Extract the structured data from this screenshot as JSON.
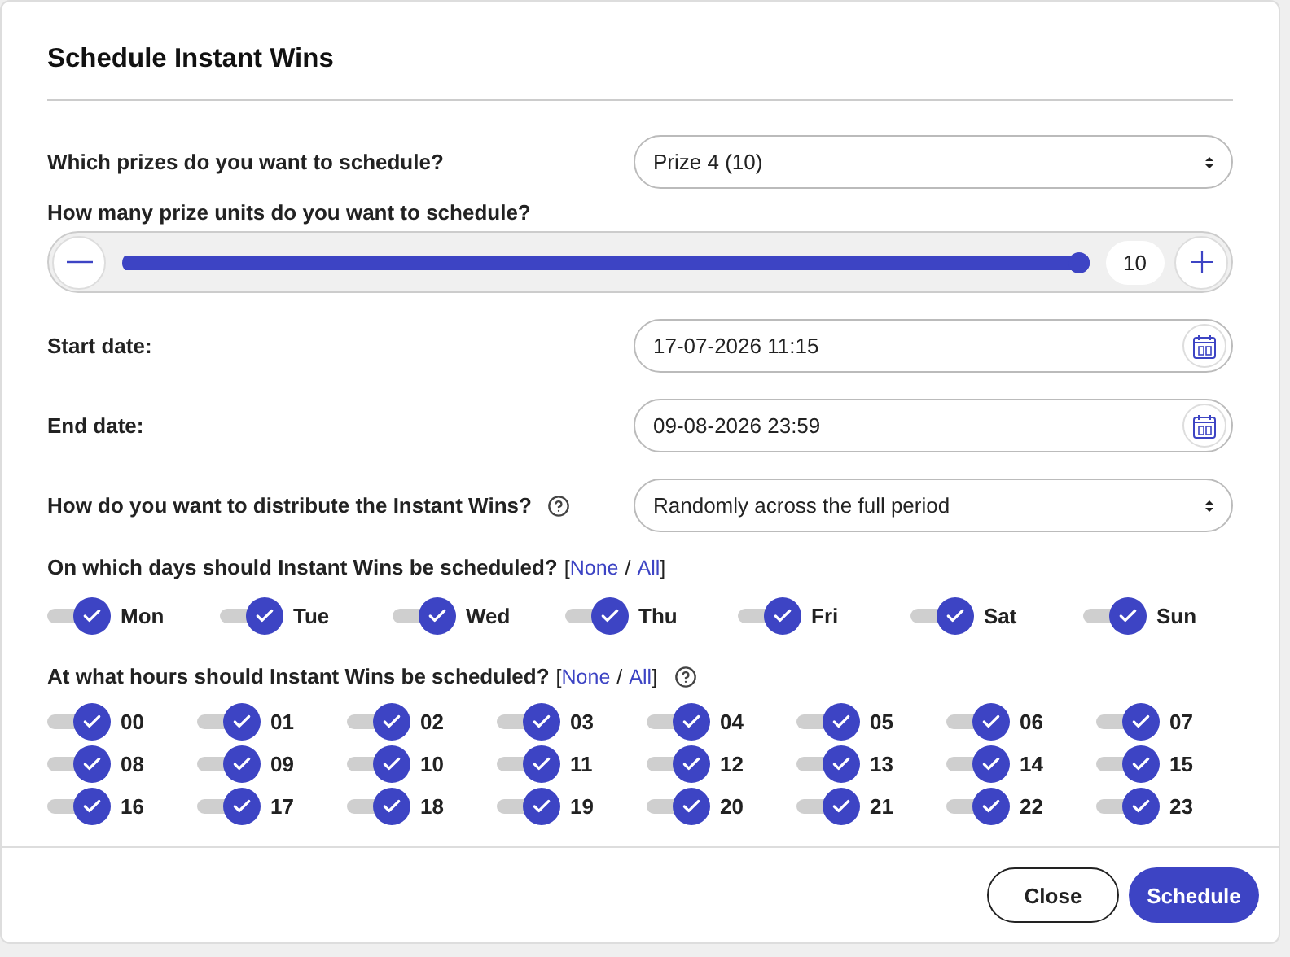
{
  "dialog": {
    "title": "Schedule Instant Wins"
  },
  "prizes": {
    "label": "Which prizes do you want to schedule?",
    "value": "Prize 4 (10)"
  },
  "units": {
    "label": "How many prize units do you want to schedule?",
    "level": 1,
    "value": "10"
  },
  "start_date": {
    "label": "Start date:",
    "value": "17-07-2026 11:15"
  },
  "end_date": {
    "label": "End date:",
    "value": "09-08-2026 23:59"
  },
  "distribution": {
    "label": "How do you want to distribute the Instant Wins?",
    "help": true,
    "value": "Randomly across the full period"
  },
  "days": {
    "label": "On which days should Instant Wins be scheduled?",
    "bracket_open": "[",
    "none": "None",
    "separator": "/",
    "all": "All",
    "bracket_close": "]",
    "items": [
      {
        "label": "Mon",
        "checked": true
      },
      {
        "label": "Tue",
        "checked": true
      },
      {
        "label": "Wed",
        "checked": true
      },
      {
        "label": "Thu",
        "checked": true
      },
      {
        "label": "Fri",
        "checked": true
      },
      {
        "label": "Sat",
        "checked": true
      },
      {
        "label": "Sun",
        "checked": true
      }
    ]
  },
  "hours": {
    "label": "At what hours should Instant Wins be scheduled?",
    "bracket_open": "[",
    "none": "None",
    "separator": "/",
    "all": "All",
    "bracket_close": "]",
    "help": true,
    "items": [
      {
        "label": "00",
        "checked": true
      },
      {
        "label": "01",
        "checked": true
      },
      {
        "label": "02",
        "checked": true
      },
      {
        "label": "03",
        "checked": true
      },
      {
        "label": "04",
        "checked": true
      },
      {
        "label": "05",
        "checked": true
      },
      {
        "label": "06",
        "checked": true
      },
      {
        "label": "07",
        "checked": true
      },
      {
        "label": "08",
        "checked": true
      },
      {
        "label": "09",
        "checked": true
      },
      {
        "label": "10",
        "checked": true
      },
      {
        "label": "11",
        "checked": true
      },
      {
        "label": "12",
        "checked": true
      },
      {
        "label": "13",
        "checked": true
      },
      {
        "label": "14",
        "checked": true
      },
      {
        "label": "15",
        "checked": true
      },
      {
        "label": "16",
        "checked": true
      },
      {
        "label": "17",
        "checked": true
      },
      {
        "label": "18",
        "checked": true
      },
      {
        "label": "19",
        "checked": true
      },
      {
        "label": "20",
        "checked": true
      },
      {
        "label": "21",
        "checked": true
      },
      {
        "label": "22",
        "checked": true
      },
      {
        "label": "23",
        "checked": true
      }
    ]
  },
  "buttons": [
    {
      "label": "Close",
      "kind": "secondary"
    },
    {
      "label": "Schedule",
      "kind": "primary"
    }
  ]
}
